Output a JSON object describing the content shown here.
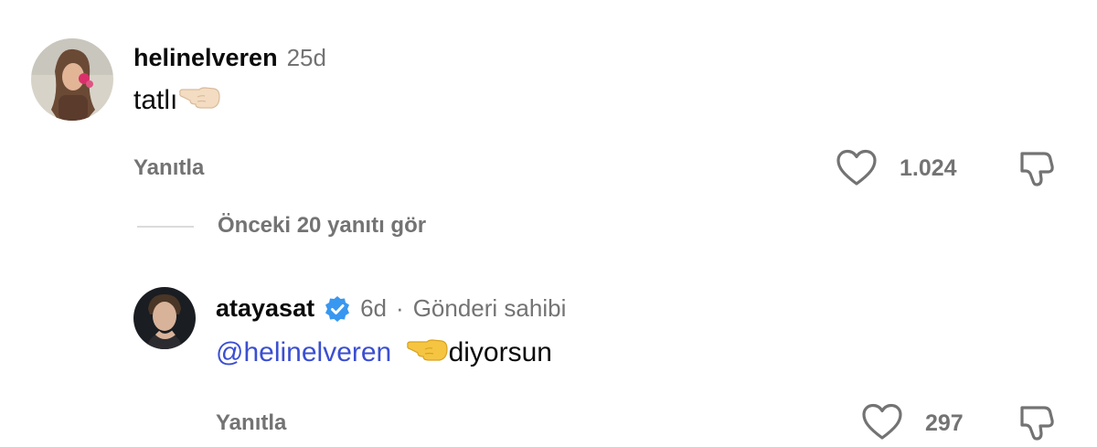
{
  "comment1": {
    "username": "helinelveren",
    "time": "25d",
    "text": "tatlı",
    "emoji_icon": "pointing-hand-left-icon",
    "reply_label": "Yanıtla",
    "like_count": "1.024"
  },
  "thread": {
    "view_replies_label": "Önceki 20 yanıtı gör"
  },
  "comment2": {
    "username": "atayasat",
    "time": "6d",
    "separator": "·",
    "author_label": "Gönderi sahibi",
    "mention": "@helinelveren",
    "text": "diyorsun",
    "emoji_icon": "pointing-hand-left-icon",
    "reply_label": "Yanıtla",
    "like_count": "297"
  },
  "colors": {
    "verified": "#3897f0",
    "mention": "#3b4fd1",
    "muted": "#737373"
  }
}
